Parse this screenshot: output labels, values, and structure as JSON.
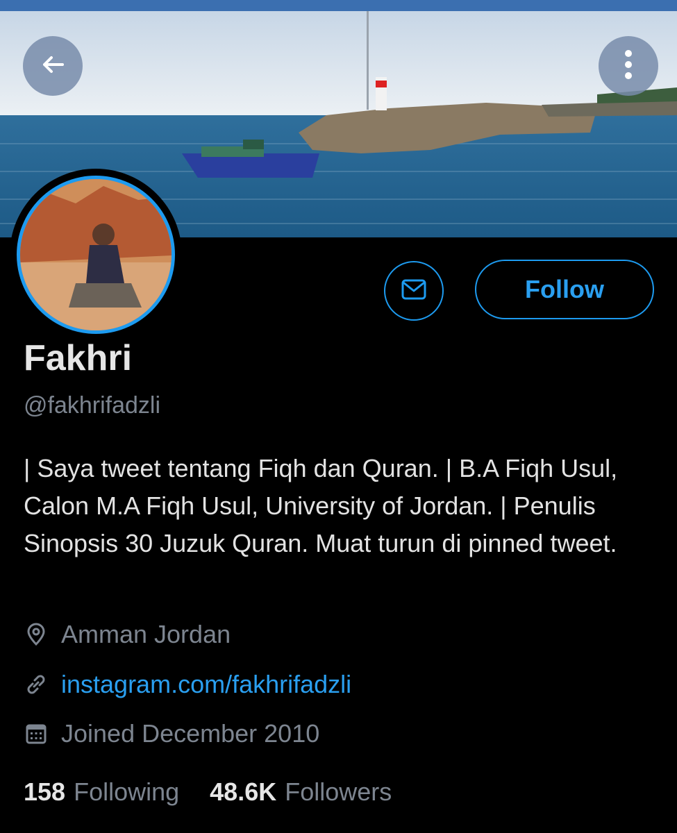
{
  "profile": {
    "name": "Fakhri",
    "handle": "@fakhrifadzli",
    "bio": "| Saya tweet tentang Fiqh dan Quran. | B.A Fiqh Usul, Calon M.A Fiqh Usul, University of Jordan. | Penulis Sinopsis 30 Juzuk Quran. Muat turun di pinned tweet.",
    "location": "Amman Jordan",
    "website": "instagram.com/fakhrifadzli",
    "joined": "Joined December 2010"
  },
  "actions": {
    "follow_label": "Follow"
  },
  "stats": {
    "following_count": "158",
    "following_label": "Following",
    "followers_count": "48.6K",
    "followers_label": "Followers"
  },
  "icons": {
    "back": "arrow-left-icon",
    "more": "more-vertical-icon",
    "message": "envelope-icon",
    "location": "location-pin-icon",
    "link": "link-icon",
    "calendar": "calendar-icon"
  },
  "colors": {
    "accent": "#1d9bf0",
    "background": "#000000",
    "muted_text": "#7d8590"
  }
}
